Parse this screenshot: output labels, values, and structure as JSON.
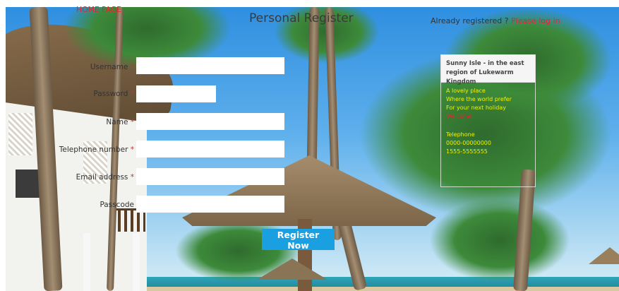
{
  "header": {
    "home_link": "HOME PAGE",
    "title": "Personal Register",
    "already_registered": "Already registered ?",
    "login_link": "Please log in"
  },
  "form": {
    "fields": [
      {
        "label": "Username",
        "required": "*",
        "value": ""
      },
      {
        "label": "Password",
        "required": "*",
        "value": ""
      },
      {
        "label": "Name",
        "required": "*",
        "value": ""
      },
      {
        "label": "Telephone number",
        "required": "*",
        "value": ""
      },
      {
        "label": "Email address",
        "required": "*",
        "value": ""
      },
      {
        "label": "Passcode",
        "required": "",
        "value": ""
      }
    ],
    "submit_label": "Register Now"
  },
  "info_panel": {
    "title": "Sunny Isle - in the east region of Lukewarm Kingdom",
    "lines": [
      "A lovely place",
      "Where the world prefer",
      "For your next holiday",
      "Welcome"
    ],
    "telephone_label": "Telephone",
    "phone_1": "0000-00000000",
    "phone_2": "1555-5555555"
  },
  "colors": {
    "accent_red": "#e3262c",
    "button_blue": "#1a9fe0",
    "info_yellow": "#f2f200"
  }
}
